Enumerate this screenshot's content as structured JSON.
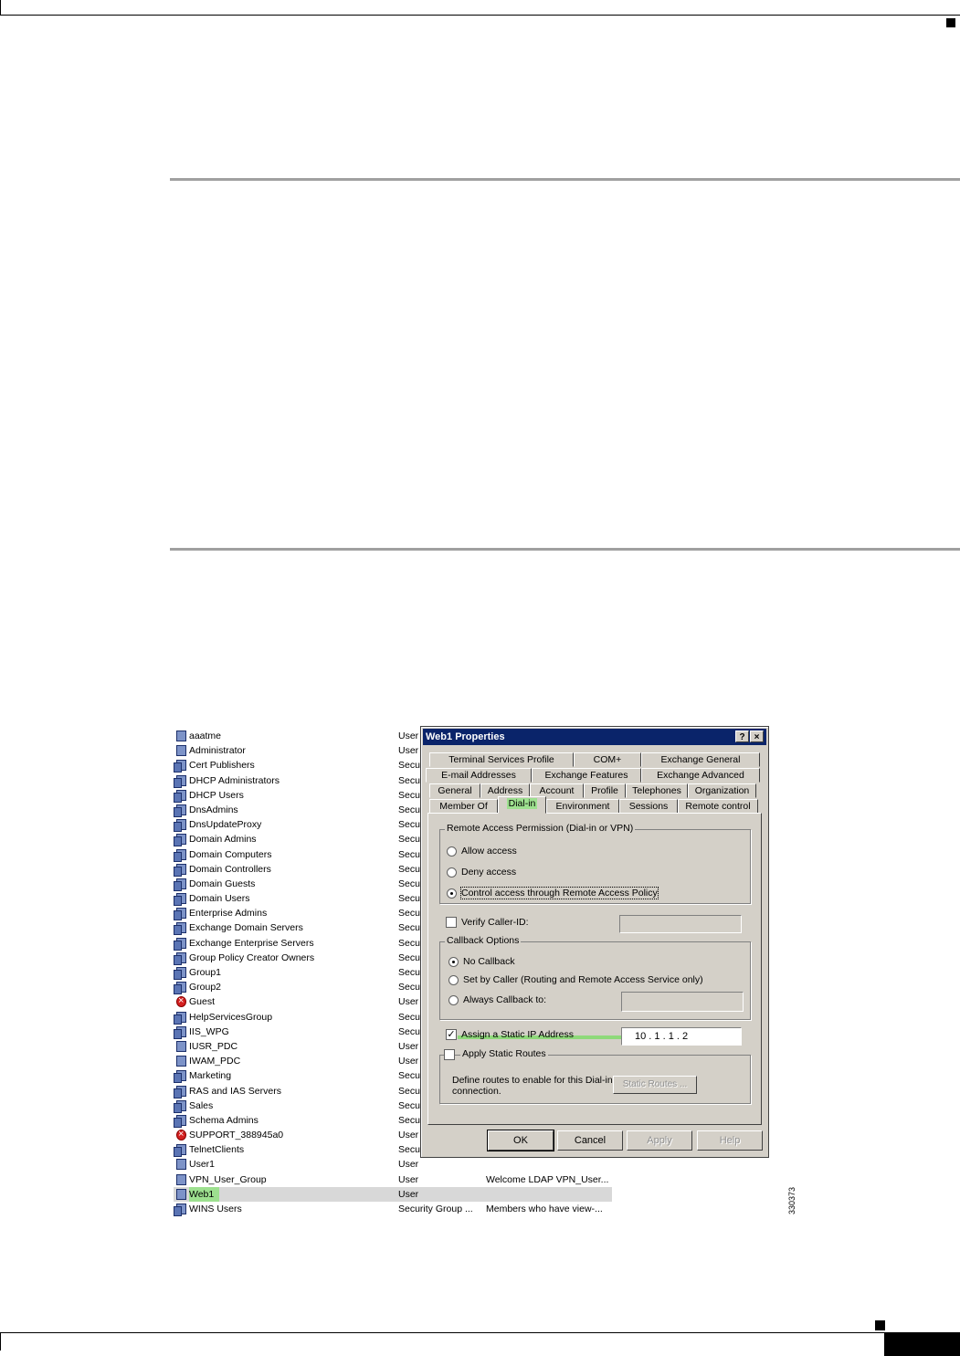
{
  "users_list": {
    "rows": [
      {
        "name": "aaatme",
        "type": "User",
        "desc": "",
        "icon": "user-icon"
      },
      {
        "name": "Administrator",
        "type": "User",
        "desc": "",
        "icon": "user-icon"
      },
      {
        "name": "Cert Publishers",
        "type": "Secu",
        "desc": "",
        "icon": "group-icon"
      },
      {
        "name": "DHCP Administrators",
        "type": "Secu",
        "desc": "",
        "icon": "group-icon"
      },
      {
        "name": "DHCP Users",
        "type": "Secu",
        "desc": "",
        "icon": "group-icon"
      },
      {
        "name": "DnsAdmins",
        "type": "Secu",
        "desc": "",
        "icon": "group-icon"
      },
      {
        "name": "DnsUpdateProxy",
        "type": "Secu",
        "desc": "",
        "icon": "group-icon"
      },
      {
        "name": "Domain Admins",
        "type": "Secu",
        "desc": "",
        "icon": "group-icon"
      },
      {
        "name": "Domain Computers",
        "type": "Secu",
        "desc": "",
        "icon": "group-icon"
      },
      {
        "name": "Domain Controllers",
        "type": "Secu",
        "desc": "",
        "icon": "group-icon"
      },
      {
        "name": "Domain Guests",
        "type": "Secu",
        "desc": "",
        "icon": "group-icon"
      },
      {
        "name": "Domain Users",
        "type": "Secu",
        "desc": "",
        "icon": "group-icon"
      },
      {
        "name": "Enterprise Admins",
        "type": "Secu",
        "desc": "",
        "icon": "group-icon"
      },
      {
        "name": "Exchange Domain Servers",
        "type": "Secu",
        "desc": "",
        "icon": "group-icon"
      },
      {
        "name": "Exchange Enterprise Servers",
        "type": "Secu",
        "desc": "",
        "icon": "group-icon"
      },
      {
        "name": "Group Policy Creator Owners",
        "type": "Secu",
        "desc": "",
        "icon": "group-icon"
      },
      {
        "name": "Group1",
        "type": "Secu",
        "desc": "",
        "icon": "group-icon"
      },
      {
        "name": "Group2",
        "type": "Secu",
        "desc": "",
        "icon": "group-icon"
      },
      {
        "name": "Guest",
        "type": "User",
        "desc": "",
        "icon": "disabled-user-icon"
      },
      {
        "name": "HelpServicesGroup",
        "type": "Secu",
        "desc": "",
        "icon": "group-icon"
      },
      {
        "name": "IIS_WPG",
        "type": "Secu",
        "desc": "",
        "icon": "group-icon"
      },
      {
        "name": "IUSR_PDC",
        "type": "User",
        "desc": "",
        "icon": "user-icon"
      },
      {
        "name": "IWAM_PDC",
        "type": "User",
        "desc": "",
        "icon": "user-icon"
      },
      {
        "name": "Marketing",
        "type": "Secu",
        "desc": "",
        "icon": "group-icon"
      },
      {
        "name": "RAS and IAS Servers",
        "type": "Secu",
        "desc": "",
        "icon": "group-icon"
      },
      {
        "name": "Sales",
        "type": "Secu",
        "desc": "",
        "icon": "group-icon"
      },
      {
        "name": "Schema Admins",
        "type": "Secu",
        "desc": "",
        "icon": "group-icon"
      },
      {
        "name": "SUPPORT_388945a0",
        "type": "User",
        "desc": "",
        "icon": "disabled-user-icon"
      },
      {
        "name": "TelnetClients",
        "type": "Secu",
        "desc": "",
        "icon": "group-icon"
      },
      {
        "name": "User1",
        "type": "User",
        "desc": "",
        "icon": "user-icon"
      },
      {
        "name": "VPN_User_Group",
        "type": "User",
        "desc": "Welcome LDAP VPN_User...",
        "icon": "user-icon"
      },
      {
        "name": "Web1",
        "type": "User",
        "desc": "",
        "icon": "user-icon",
        "selected": true
      },
      {
        "name": "WINS Users",
        "type": "Security Group ...",
        "desc": "Members who have view-...",
        "icon": "group-icon"
      }
    ]
  },
  "dialog": {
    "title": "Web1 Properties",
    "help_button": "?",
    "close_button": "×",
    "tabs_row1": [
      "Terminal Services Profile",
      "COM+",
      "Exchange General"
    ],
    "tabs_row2": [
      "E-mail Addresses",
      "Exchange Features",
      "Exchange Advanced"
    ],
    "tabs_row3": [
      "General",
      "Address",
      "Account",
      "Profile",
      "Telephones",
      "Organization"
    ],
    "tabs_row4": [
      "Member Of",
      "Dial-in",
      "Environment",
      "Sessions",
      "Remote control"
    ],
    "active_tab": "Dial-in",
    "remote_access": {
      "legend": "Remote Access Permission (Dial-in or VPN)",
      "allow": "Allow access",
      "deny": "Deny access",
      "policy": "Control access through Remote Access Policy",
      "selected": "policy"
    },
    "verify_caller_id": {
      "label": "Verify Caller-ID:",
      "checked": false,
      "value": ""
    },
    "callback": {
      "legend": "Callback Options",
      "none": "No Callback",
      "by_caller": "Set by Caller (Routing and Remote Access Service only)",
      "always": "Always Callback to:",
      "selected": "none",
      "always_value": ""
    },
    "static_ip": {
      "label": "Assign a Static IP Address",
      "checked": true,
      "value": "10  .  1  .  1  .  2"
    },
    "static_routes": {
      "label": "Apply Static Routes",
      "checked": false,
      "desc": "Define routes to enable for this Dial-in connection.",
      "button": "Static Routes ..."
    },
    "buttons": {
      "ok": "OK",
      "cancel": "Cancel",
      "apply": "Apply",
      "help": "Help"
    }
  },
  "figure_number": "330373",
  "colors": {
    "highlight": "#8ed97a",
    "titlebar": "#0a246a",
    "dialog_face": "#d4d0c8"
  }
}
